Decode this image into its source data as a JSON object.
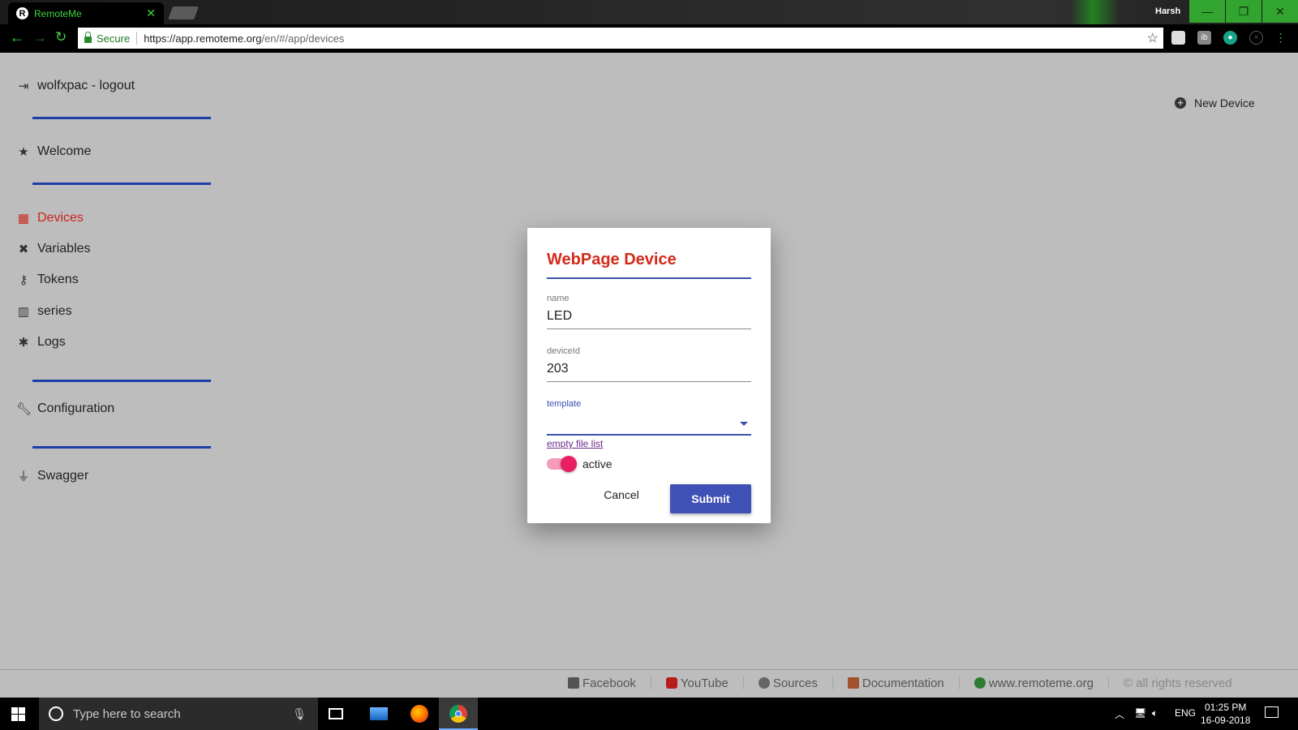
{
  "browser": {
    "tab_title": "RemoteMe",
    "tab_favicon_letter": "R",
    "user_name": "Harsh",
    "secure_label": "Secure",
    "url_host": "https://app.remoteme.org",
    "url_path": "/en/#/app/devices"
  },
  "sidebar": {
    "logout": "wolfxpac - logout",
    "welcome": "Welcome",
    "items": [
      {
        "label": "Devices",
        "icon": "chip-icon"
      },
      {
        "label": "Variables",
        "icon": "variable-icon"
      },
      {
        "label": "Tokens",
        "icon": "key-icon"
      },
      {
        "label": "series",
        "icon": "bar-chart-icon"
      },
      {
        "label": "Logs",
        "icon": "bug-icon"
      }
    ],
    "configuration": "Configuration",
    "swagger": "Swagger"
  },
  "main": {
    "new_device": "New Device"
  },
  "dialog": {
    "title": "WebPage Device",
    "name_label": "name",
    "name_value": "LED",
    "deviceid_label": "deviceId",
    "deviceid_value": "203",
    "template_label": "template",
    "template_value": "",
    "empty_file_list": "empty file list",
    "active_label": "active",
    "active": true,
    "cancel": "Cancel",
    "submit": "Submit"
  },
  "footer": {
    "facebook": "Facebook",
    "youtube": "YouTube",
    "sources": "Sources",
    "documentation": "Documentation",
    "website": "www.remoteme.org",
    "rights": "© all rights reserved"
  },
  "taskbar": {
    "search_placeholder": "Type here to search",
    "language": "ENG",
    "time": "01:25 PM",
    "date": "16-09-2018"
  },
  "colors": {
    "accent_red": "#d42a1a",
    "primary_blue": "#3f51b5",
    "toggle_pink": "#e91e63",
    "browser_green": "#3fd63f"
  }
}
